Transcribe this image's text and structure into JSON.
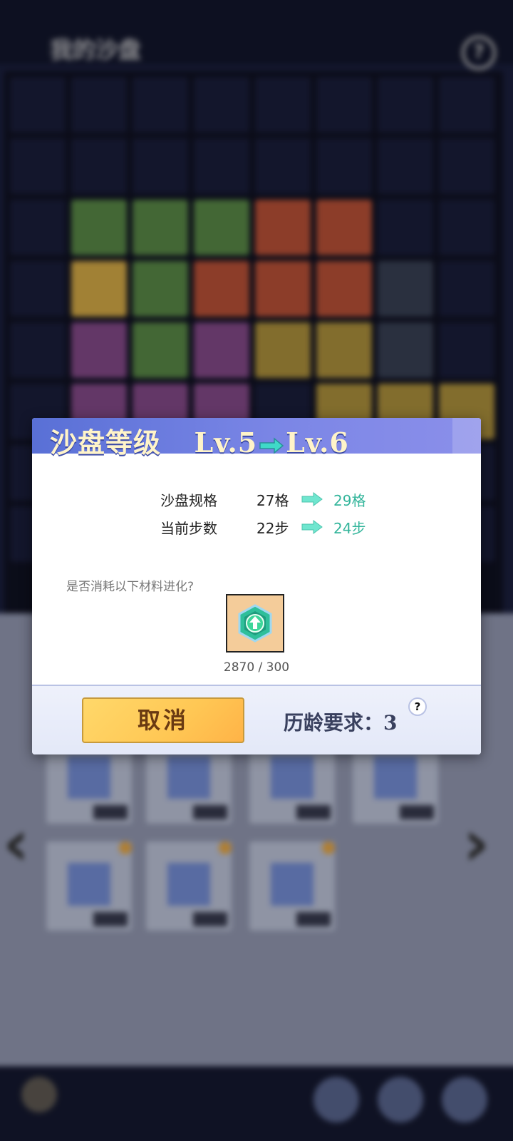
{
  "background": {
    "page_title": "我的沙盘",
    "help_glyph": "?",
    "left_nav_glyph": "‹",
    "right_nav_glyph": "›"
  },
  "dialog": {
    "title": {
      "prefix": "沙盘等级",
      "from_level": "Lv.5",
      "to_level": "Lv.6"
    },
    "stats": [
      {
        "label": "沙盘规格",
        "old": "27格",
        "new": "29格"
      },
      {
        "label": "当前步数",
        "old": "22步",
        "new": "24步"
      }
    ],
    "question": "是否消耗以下材料进化?",
    "material": {
      "icon": "upgrade-crystal-icon",
      "count": "2870 / 300"
    },
    "cancel_label": "取消",
    "requirement": "历龄要求：3",
    "requirement_help": "?"
  },
  "colors": {
    "accent_new_value": "#33b59b",
    "header_blue": "#5970d6",
    "button_yellow": "#ffc754"
  }
}
